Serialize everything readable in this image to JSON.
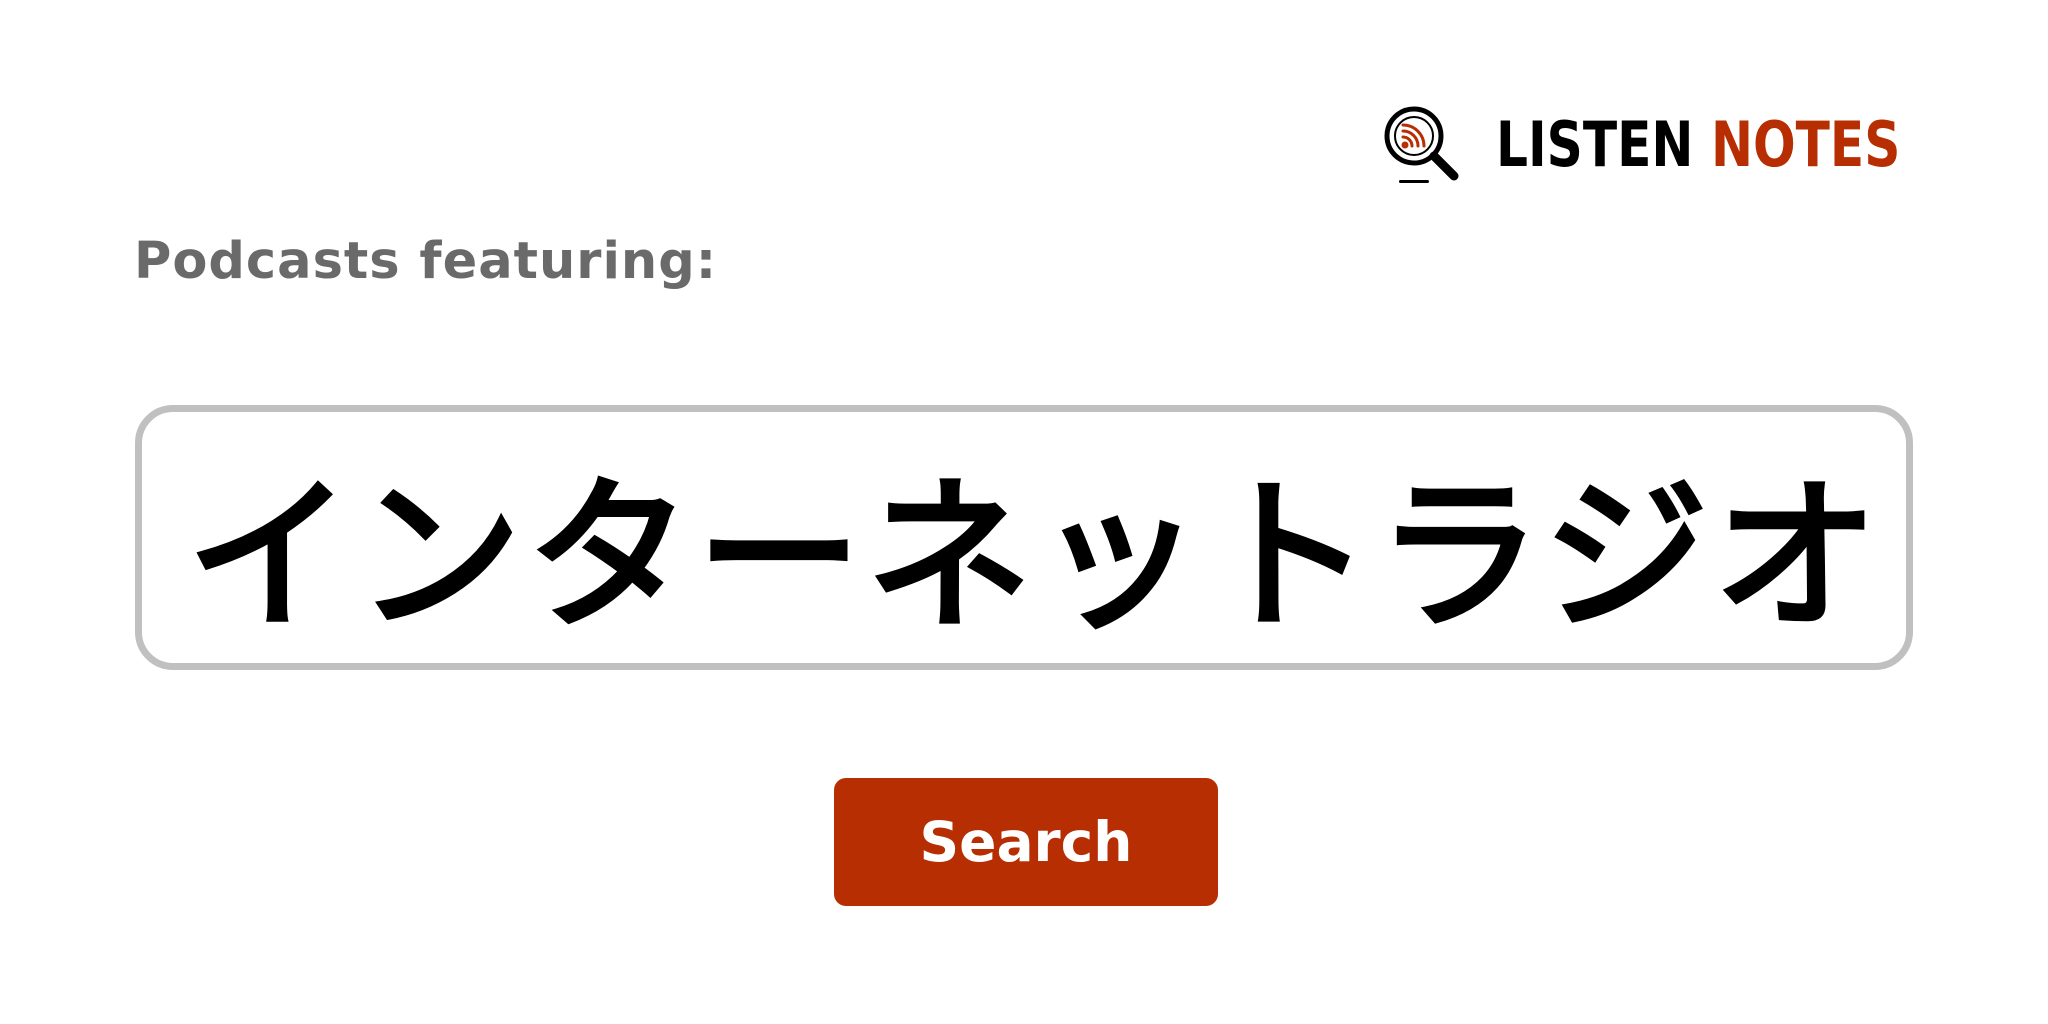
{
  "brand": {
    "word_1": "LISTEN",
    "word_2": "NOTES",
    "color_dark": "#000000",
    "color_accent": "#b72e02",
    "icon": "magnifier-rss-icon"
  },
  "heading": {
    "label": "Podcasts featuring:"
  },
  "search": {
    "value": "インターネットラジオ"
  },
  "actions": {
    "search_label": "Search"
  },
  "colors": {
    "button_bg": "#b72e02",
    "input_border": "#c0c0c0",
    "heading_text": "#6a6a6a"
  }
}
